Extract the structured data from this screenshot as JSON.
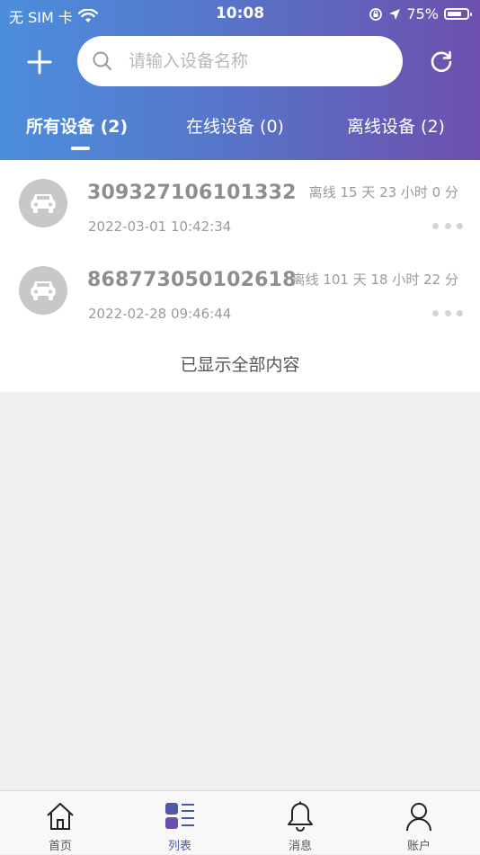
{
  "status_bar": {
    "carrier": "无 SIM 卡",
    "time": "10:08",
    "battery": "75%",
    "battery_level": 0.75
  },
  "header": {
    "search_placeholder": "请输入设备名称",
    "add_icon": "plus-icon",
    "refresh_icon": "refresh-icon"
  },
  "tabs": [
    {
      "label": "所有设备 (2)",
      "active": true
    },
    {
      "label": "在线设备 (0)",
      "active": false
    },
    {
      "label": "离线设备 (2)",
      "active": false
    }
  ],
  "devices": [
    {
      "imei": "309327106101332",
      "time": "2022-03-01 10:42:34",
      "status": "离线 15 天 23 小时 0 分",
      "icon": "car-icon"
    },
    {
      "imei": "868773050102618",
      "time": "2022-02-28 09:46:44",
      "status": "离线 101 天 18 小时 22 分",
      "icon": "car-icon"
    }
  ],
  "list_end_text": "已显示全部内容",
  "tabbar": [
    {
      "label": "首页",
      "icon": "home-icon",
      "active": false
    },
    {
      "label": "列表",
      "icon": "list-icon",
      "active": true
    },
    {
      "label": "消息",
      "icon": "bell-icon",
      "active": false
    },
    {
      "label": "账户",
      "icon": "user-icon",
      "active": false
    }
  ],
  "colors": {
    "header_gradient_start": "#4c8edd",
    "header_gradient_end": "#6e4fae",
    "accent": "#4b59a8",
    "avatar_bg": "#c8c8c8"
  }
}
